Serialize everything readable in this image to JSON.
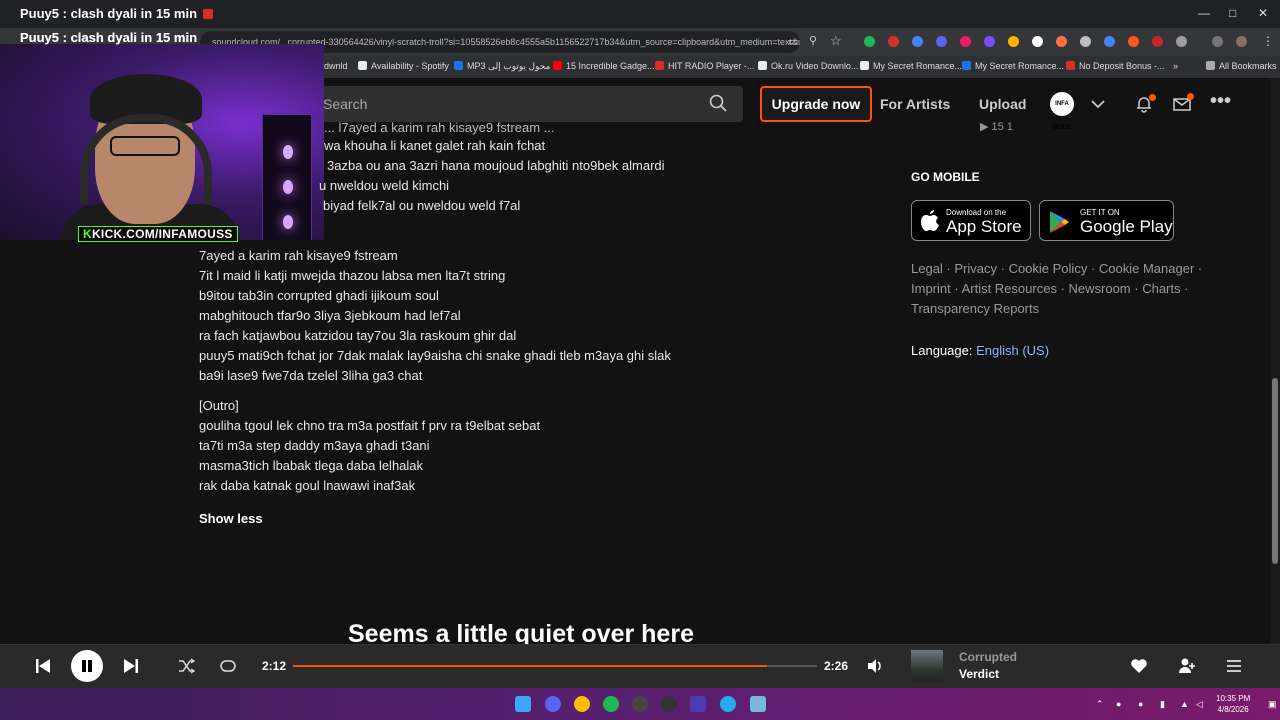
{
  "browser": {
    "tab_title": "Puuy5 : clash dyali in 15 min",
    "url": "soundcloud.com/...corrupted-330564426/vinyl-scratch-troll?si=10558526eb8c4555a5b1156522717b34&utm_source=clipboard&utm_medium=text&utm_cam...",
    "bookmarks": [
      {
        "label": "dwnld",
        "color": "#5f6368"
      },
      {
        "label": "Availability - Spotify",
        "color": "#e8eaed"
      },
      {
        "label": "MP3 محول يوتوب إلى",
        "color": "#1a73e8"
      },
      {
        "label": "15 Incredible Gadge...",
        "color": "#ff0000"
      },
      {
        "label": "HIT RADIO Player -...",
        "color": "#d93025"
      },
      {
        "label": "Ok.ru Video Downlo...",
        "color": "#e8eaed"
      },
      {
        "label": "My Secret Romance...",
        "color": "#e8eaed"
      },
      {
        "label": "My Secret Romance...",
        "color": "#1a73e8"
      },
      {
        "label": "No Deposit Bonus -...",
        "color": "#d93025"
      }
    ],
    "all_bookmarks": "All Bookmarks"
  },
  "stream": {
    "title": "Puuy5 : clash dyali in 15 min",
    "kick_prefix": "K",
    "kick_url": "KICK.COM/INFAMOUSS"
  },
  "header": {
    "search_placeholder": "Search",
    "upgrade": "Upgrade now",
    "for_artists": "For Artists",
    "upload": "Upload",
    "avatar_text": "INFA MOUS"
  },
  "lyrics": [
    "... l7ayed a karim rah kisaye9 fstream ...",
    "wa khouha li kanet galet rah kain fchat",
    "3azba ou ana 3azri hana moujoud labghiti nto9bek almardi",
    "u nweldou weld kimchi",
    "biyad felk7al ou nweldou weld f7al",
    "",
    "7ayed a karim rah kisaye9 fstream",
    "7it l maid li katji mwejda thazou labsa men lta7t string",
    "b9itou tab3in corrupted ghadi ijikoum soul",
    "mabghitouch tfar9o 3liya 3jebkoum had lef7al",
    "ra fach katjawbou katzidou tay7ou 3la raskoum ghir dal",
    "puuy5 mati9ch fchat jor 7dak malak lay9aisha chi snake ghadi tleb m3aya ghi slak",
    "ba9i lase9 fwe7da tzelel 3liha ga3 chat",
    "",
    "[Outro]",
    "gouliha tgoul lek chno tra m3a postfait f prv ra t9elbat sebat",
    "ta7ti m3a step daddy m3aya ghadi t3ani",
    "masma3tich lbabak tlega daba lelhalak",
    "rak daba katnak goul lnawawi inaf3ak"
  ],
  "show_less": "Show less",
  "empty_state": "Seems a little quiet over here",
  "sidebar": {
    "go_mobile": "GO MOBILE",
    "app_store_small": "Download on the",
    "app_store_big": "App Store",
    "google_small": "GET IT ON",
    "google_big": "Google Play",
    "links": [
      "Legal",
      "Privacy",
      "Cookie Policy",
      "Cookie Manager",
      "Imprint",
      "Artist Resources",
      "Newsroom",
      "Charts",
      "Transparency Reports"
    ],
    "language_label": "Language:",
    "language_value": "English (US)",
    "stats": "15   1"
  },
  "player": {
    "current_time": "2:12",
    "total_time": "2:26",
    "progress": 0.904,
    "track_title": "Corrupted",
    "track_artist": "Verdict"
  },
  "taskbar": {
    "time": "10:35 PM",
    "date": "4/8/2026"
  },
  "colors": {
    "accent": "#ff5500",
    "background": "#121212",
    "link": "#8ab4ff"
  }
}
